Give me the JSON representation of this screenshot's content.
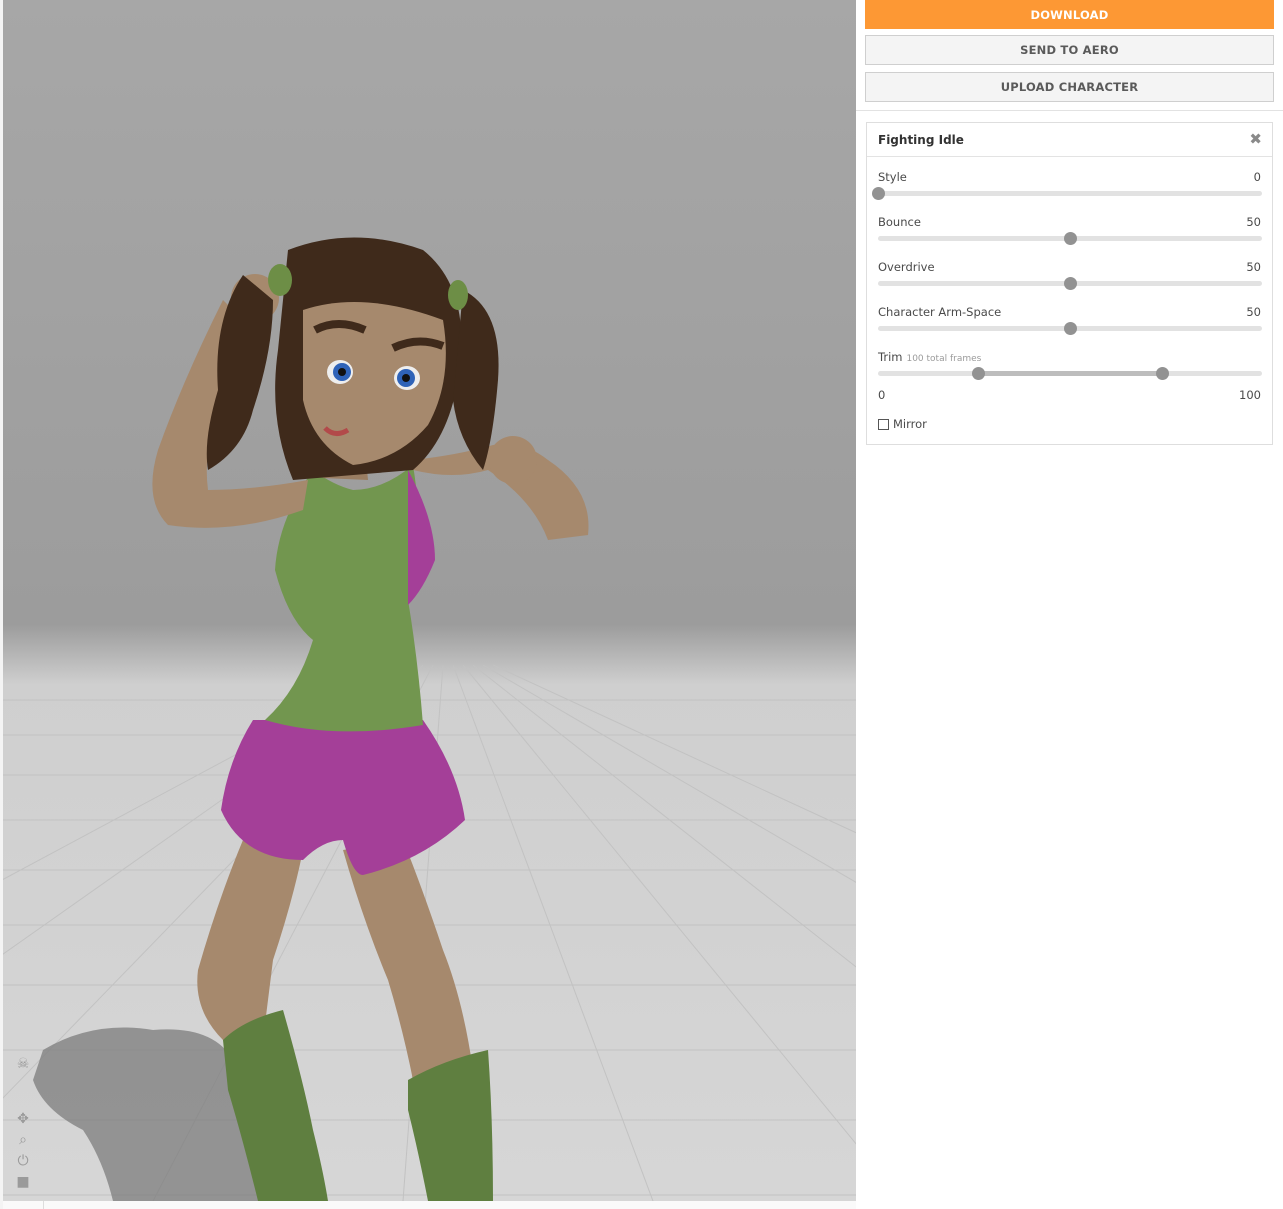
{
  "toolbar": {
    "download_label": "DOWNLOAD",
    "send_label": "SEND TO AERO",
    "upload_label": "UPLOAD CHARACTER",
    "accent_color": "#fd9834"
  },
  "animation": {
    "title": "Fighting Idle",
    "close_icon": "close-icon",
    "params": {
      "style": {
        "label": "Style",
        "value": "0",
        "fraction": 0.0
      },
      "bounce": {
        "label": "Bounce",
        "value": "50",
        "fraction": 0.5
      },
      "overdrive": {
        "label": "Overdrive",
        "value": "50",
        "fraction": 0.5
      },
      "arm_space": {
        "label": "Character Arm-Space",
        "value": "50",
        "fraction": 0.5
      }
    },
    "trim": {
      "label": "Trim",
      "sublabel": "100 total frames",
      "min_label": "0",
      "max_label": "100",
      "start_fraction": 0.26,
      "end_fraction": 0.74
    },
    "mirror": {
      "label": "Mirror",
      "checked": false
    }
  },
  "viewport": {
    "tools": [
      "skull-icon",
      "move-icon",
      "zoom-icon",
      "power-icon",
      "camera-icon"
    ]
  }
}
